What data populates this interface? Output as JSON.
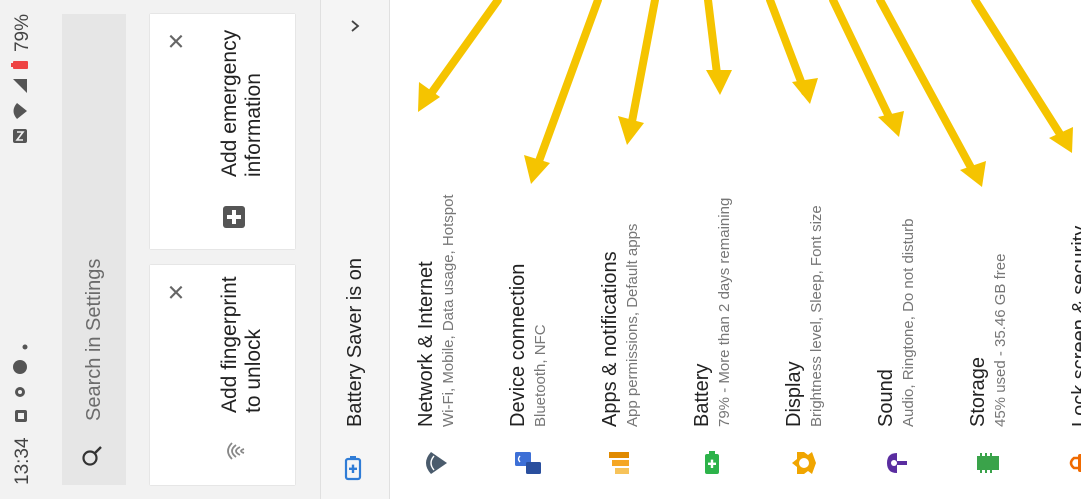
{
  "status_bar": {
    "time": "13:34",
    "battery_percent": "79%"
  },
  "search": {
    "placeholder": "Search in Settings"
  },
  "suggestions": [
    {
      "text": "Add fingerprint to unlock",
      "icon": "fingerprint-icon"
    },
    {
      "text": "Add emergency information",
      "icon": "medical-plus-icon"
    }
  ],
  "battery_saver": {
    "text": "Battery Saver is on"
  },
  "settings": [
    {
      "title": "Network & Internet",
      "subtitle": "Wi-Fi, Mobile, Data usage, Hotspot",
      "icon": "wifi-icon",
      "color": "#4a5b6c"
    },
    {
      "title": "Device connection",
      "subtitle": "Bluetooth, NFC",
      "icon": "device-connection-icon",
      "color": "#3d6fd6"
    },
    {
      "title": "Apps & notifications",
      "subtitle": "App permissions, Default apps",
      "icon": "apps-icon",
      "color": "#f5a623"
    },
    {
      "title": "Battery",
      "subtitle": "79% - More than 2 days remaining",
      "icon": "battery-icon",
      "color": "#2db34a"
    },
    {
      "title": "Display",
      "subtitle": "Brightness level, Sleep, Font size",
      "icon": "display-icon",
      "color": "#f0a500"
    },
    {
      "title": "Sound",
      "subtitle": "Audio, Ringtone, Do not disturb",
      "icon": "sound-icon",
      "color": "#5a2da0"
    },
    {
      "title": "Storage",
      "subtitle": "45% used - 35.46 GB free",
      "icon": "storage-icon",
      "color": "#3aa34a"
    },
    {
      "title": "Lock screen & security",
      "subtitle": "",
      "icon": "lock-icon",
      "color": "#f06a00"
    }
  ],
  "annotation_color": "#f5c400"
}
